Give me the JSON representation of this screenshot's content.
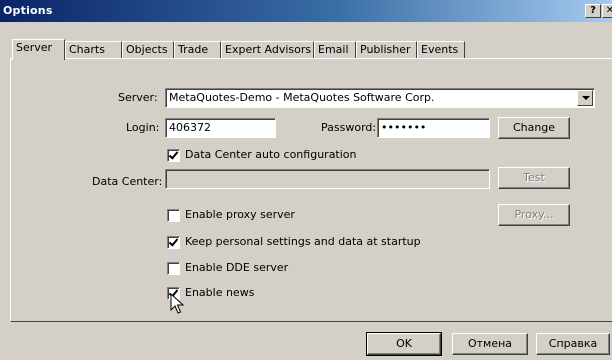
{
  "window": {
    "title": "Options",
    "help_label": "?",
    "close_label": "✕"
  },
  "tabs": [
    {
      "label": "Server"
    },
    {
      "label": "Charts"
    },
    {
      "label": "Objects"
    },
    {
      "label": "Trade"
    },
    {
      "label": "Expert Advisors"
    },
    {
      "label": "Email"
    },
    {
      "label": "Publisher"
    },
    {
      "label": "Events"
    }
  ],
  "server": {
    "label": "Server:",
    "value": "MetaQuotes-Demo - MetaQuotes Software Corp."
  },
  "login": {
    "label": "Login:",
    "value": "406372"
  },
  "password": {
    "label": "Password:",
    "value": "•••••••"
  },
  "change_button": "Change",
  "datacenter_auto": {
    "label": "Data Center auto configuration",
    "checked": true
  },
  "datacenter": {
    "label": "Data Center:",
    "value": ""
  },
  "test_button": "Test",
  "proxy": {
    "label": "Enable proxy server",
    "checked": false
  },
  "proxy_button": "Proxy...",
  "keep_settings": {
    "label": "Keep personal settings and data at startup",
    "checked": true
  },
  "dde": {
    "label": "Enable DDE server",
    "checked": false
  },
  "news": {
    "label": "Enable news",
    "checked": true
  },
  "footer": {
    "ok": "OK",
    "cancel": "Отмена",
    "help": "Справка"
  }
}
